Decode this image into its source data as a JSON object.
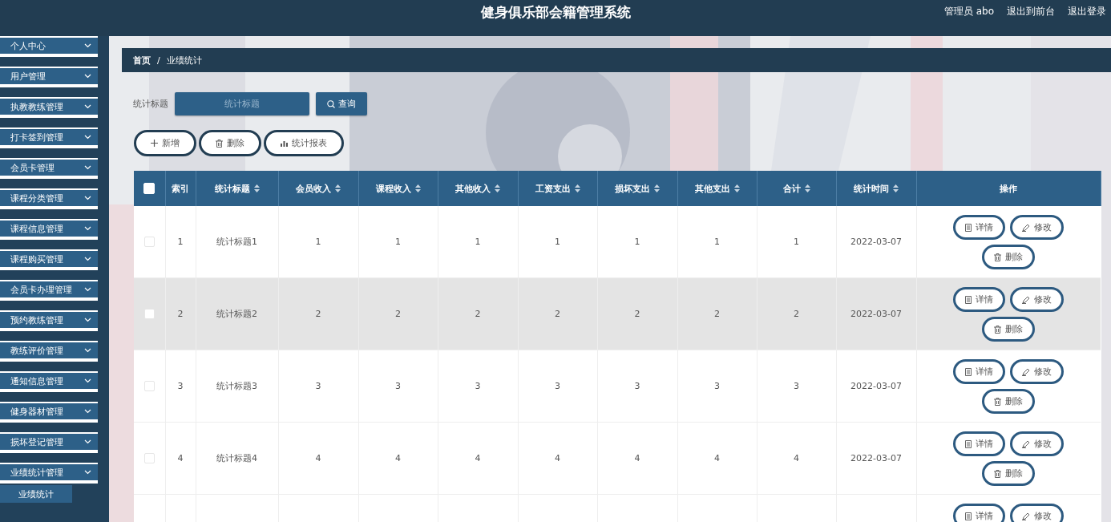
{
  "header": {
    "title": "健身俱乐部会籍管理系统",
    "links": [
      "管理员 abo",
      "退出到前台",
      "退出登录"
    ]
  },
  "sidebar": {
    "items": [
      {
        "label": "个人中心"
      },
      {
        "label": "用户管理"
      },
      {
        "label": "执教教练管理"
      },
      {
        "label": "打卡签到管理"
      },
      {
        "label": "会员卡管理"
      },
      {
        "label": "课程分类管理"
      },
      {
        "label": "课程信息管理"
      },
      {
        "label": "课程购买管理"
      },
      {
        "label": "会员卡办理管理"
      },
      {
        "label": "预约教练管理"
      },
      {
        "label": "教练评价管理"
      },
      {
        "label": "通知信息管理"
      },
      {
        "label": "健身器材管理"
      },
      {
        "label": "损坏登记管理"
      },
      {
        "label": "业绩统计管理",
        "children": [
          {
            "label": "业绩统计"
          }
        ]
      }
    ]
  },
  "breadcrumb": [
    "首页",
    "/",
    "业绩统计"
  ],
  "search": {
    "label": "统计标题",
    "placeholder": "统计标题",
    "button": "查询"
  },
  "actions": [
    {
      "kind": "add",
      "label": "新增"
    },
    {
      "kind": "delete",
      "label": "删除"
    },
    {
      "kind": "chart",
      "label": "统计报表"
    }
  ],
  "table": {
    "select_all_checked": false,
    "columns": [
      {
        "label": "索引",
        "sortable": false
      },
      {
        "label": "统计标题",
        "sortable": true
      },
      {
        "label": "会员收入",
        "sortable": true
      },
      {
        "label": "课程收入",
        "sortable": true
      },
      {
        "label": "其他收入",
        "sortable": true
      },
      {
        "label": "工资支出",
        "sortable": true
      },
      {
        "label": "损坏支出",
        "sortable": true
      },
      {
        "label": "其他支出",
        "sortable": true
      },
      {
        "label": "合计",
        "sortable": true
      },
      {
        "label": "统计时间",
        "sortable": true
      },
      {
        "label": "操作",
        "sortable": false
      }
    ],
    "rows": [
      {
        "checked": false,
        "hovered": false,
        "cells": [
          "1",
          "统计标题1",
          "1",
          "1",
          "1",
          "1",
          "1",
          "1",
          "1",
          "2022-03-07"
        ],
        "buttons": [
          {
            "kind": "detail",
            "label": "详情"
          },
          {
            "kind": "edit",
            "label": "修改"
          },
          {
            "kind": "delete",
            "label": "删除"
          }
        ]
      },
      {
        "checked": false,
        "hovered": true,
        "cells": [
          "2",
          "统计标题2",
          "2",
          "2",
          "2",
          "2",
          "2",
          "2",
          "2",
          "2022-03-07"
        ],
        "buttons": [
          {
            "kind": "detail",
            "label": "详情"
          },
          {
            "kind": "edit",
            "label": "修改"
          },
          {
            "kind": "delete",
            "label": "删除"
          }
        ]
      },
      {
        "checked": false,
        "hovered": false,
        "cells": [
          "3",
          "统计标题3",
          "3",
          "3",
          "3",
          "3",
          "3",
          "3",
          "3",
          "2022-03-07"
        ],
        "buttons": [
          {
            "kind": "detail",
            "label": "详情"
          },
          {
            "kind": "edit",
            "label": "修改"
          },
          {
            "kind": "delete",
            "label": "删除"
          }
        ]
      },
      {
        "checked": false,
        "hovered": false,
        "cells": [
          "4",
          "统计标题4",
          "4",
          "4",
          "4",
          "4",
          "4",
          "4",
          "4",
          "2022-03-07"
        ],
        "buttons": [
          {
            "kind": "detail",
            "label": "详情"
          },
          {
            "kind": "edit",
            "label": "修改"
          },
          {
            "kind": "delete",
            "label": "删除"
          }
        ]
      },
      {
        "hovered": false,
        "buttons": [
          {
            "kind": "detail",
            "label": "详情"
          },
          {
            "kind": "edit",
            "label": "修改"
          }
        ]
      }
    ]
  }
}
